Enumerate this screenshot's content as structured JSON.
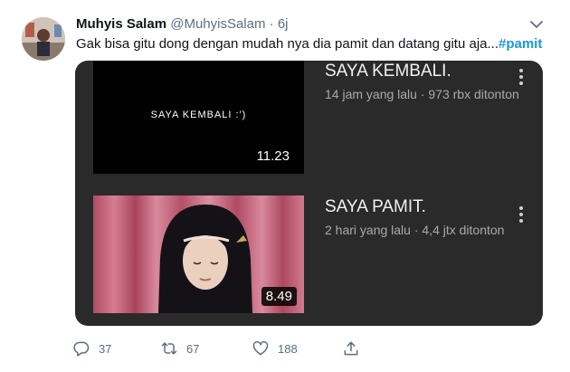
{
  "tweet": {
    "author_name": "Muhyis Salam",
    "author_handle": "@MuhyisSalam",
    "separator": "·",
    "timestamp": "6j",
    "text": "Gak bisa gitu dong dengan mudah nya dia pamit dan datang gitu aja...",
    "hashtag": "#pamit"
  },
  "media": {
    "videos": [
      {
        "thumbnail_caption": "SAYA KEMBALI :')",
        "duration": "11.23",
        "title": "SAYA KEMBALI.",
        "meta": "14 jam yang lalu · 973 rbx ditonton"
      },
      {
        "thumbnail_caption": "",
        "duration": "8.49",
        "title": "SAYA PAMIT.",
        "meta": "2 hari yang lalu · 4,4 jtx ditonton"
      }
    ]
  },
  "actions": {
    "reply_count": "37",
    "retweet_count": "67",
    "like_count": "188"
  },
  "icons": [
    "reply-icon",
    "retweet-icon",
    "like-icon",
    "share-icon",
    "caret-down-icon",
    "more-vertical-icon"
  ],
  "colors": {
    "accent": "#1b95e0",
    "muted": "#5b7083",
    "card_bg": "#2a2a2a"
  }
}
